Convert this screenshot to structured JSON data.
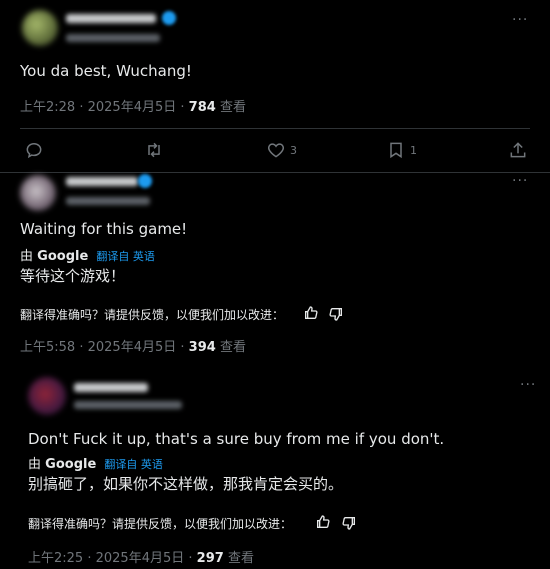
{
  "posts": [
    {
      "text": "You da best, Wuchang!",
      "time": "上午2:28",
      "date": "2025年4月5日",
      "views": "784",
      "views_label": "查看",
      "actions": {
        "reply_icon": "reply-icon",
        "repost_icon": "repost-icon",
        "like_icon": "heart-icon",
        "like_count": "3",
        "bookmark_icon": "bookmark-icon",
        "bookmark_count": "1",
        "share_icon": "share-icon"
      }
    },
    {
      "text": "Waiting for this game!",
      "translated_by": "由",
      "translated_engine": "Google",
      "translated_from": "翻译自 英语",
      "translation": "等待这个游戏！",
      "feedback": "翻译得准确吗？请提供反馈，以便我们加以改进：",
      "time": "上午5:58",
      "date": "2025年4月5日",
      "views": "394",
      "views_label": "查看"
    },
    {
      "text": "Don't Fuck it up, that's a sure buy from me if you don't.",
      "translated_by": "由",
      "translated_engine": "Google",
      "translated_from": "翻译自 英语",
      "translation": "别搞砸了，如果你不这样做，那我肯定会买的。",
      "feedback": "翻译得准确吗？请提供反馈，以便我们加以改进：",
      "time": "上午2:25",
      "date": "2025年4月5日",
      "views": "297",
      "views_label": "查看"
    }
  ],
  "more_label": "···",
  "colors": {
    "accent": "#1d9bf0",
    "muted": "#71767b",
    "text": "#e7e9ea",
    "border": "#2f3336"
  }
}
